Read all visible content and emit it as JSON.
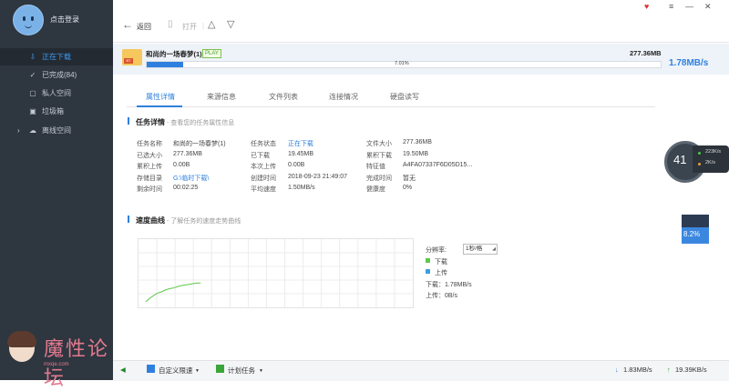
{
  "sidebar": {
    "login": "点击登录",
    "items": [
      {
        "icon": "download-icon",
        "glyph": "⇩",
        "label": "正在下载"
      },
      {
        "icon": "check-circle-icon",
        "glyph": "✓",
        "label": "已完成(84)"
      },
      {
        "icon": "lock-icon",
        "glyph": "▢",
        "label": "私人空间"
      },
      {
        "icon": "trash-icon",
        "glyph": "▣",
        "label": "垃圾箱"
      },
      {
        "icon": "cloud-icon",
        "glyph": "☁",
        "label": "离线空间"
      }
    ],
    "watermark": {
      "text": "魔性论坛",
      "sub": "mxqe.com"
    }
  },
  "toolbar": {
    "back": "返回",
    "open": "打开"
  },
  "task": {
    "name": "和尚的一场春梦(1)",
    "play": "PLAY",
    "size": "277.36MB",
    "progress_pct": 7.01,
    "progress_label": "7.01%",
    "speed": "1.78MB/s"
  },
  "tabs": [
    "属性详情",
    "来源信息",
    "文件列表",
    "连接情况",
    "硬盘读写"
  ],
  "details": {
    "title": "任务详情",
    "subtitle": " - 查看您的任务属性信息",
    "col1": [
      [
        "任务名称",
        "和尚的一场春梦(1)"
      ],
      [
        "已选大小",
        "277.36MB"
      ],
      [
        "累积上传",
        "0.00B"
      ],
      [
        "存储目录",
        "G:\\临时下载\\"
      ],
      [
        "剩余时间",
        "00:02:25"
      ]
    ],
    "col2": [
      [
        "任务状态",
        "正在下载"
      ],
      [
        "已下载",
        "19.45MB"
      ],
      [
        "本次上传",
        "0.00B"
      ],
      [
        "创建时间",
        "2018-09-23 21:49:07"
      ],
      [
        "平均速度",
        "1.50MB/s"
      ]
    ],
    "col3": [
      [
        "文件大小",
        "277.36MB"
      ],
      [
        "累积下载",
        "19.50MB"
      ],
      [
        "特征值",
        "A4FA07337F6D05D15..."
      ],
      [
        "完成时间",
        "暂无"
      ],
      [
        "健康度",
        "0%"
      ]
    ]
  },
  "speed_curve": {
    "title": "速度曲线",
    "subtitle": " - 了解任务的速度走势曲线",
    "resolution_label": "分辨率:",
    "resolution_value": "1秒/格",
    "legend_download": "下载",
    "legend_upload": "上传",
    "download_readout": "下载：1.78MB/s",
    "upload_readout": "上传：0B/s",
    "colors": {
      "download": "#5ec84a",
      "upload": "#3a9ee0"
    }
  },
  "chart_data": {
    "type": "line",
    "series": [
      {
        "name": "下载",
        "x": [
          0,
          1,
          2,
          3,
          4,
          5,
          6,
          7,
          8,
          9,
          10,
          11,
          12,
          13,
          14
        ],
        "values": [
          0.0,
          0.3,
          0.5,
          0.7,
          0.8,
          0.95,
          1.05,
          1.1,
          1.2,
          1.3,
          1.35,
          1.4,
          1.45,
          1.5,
          1.5
        ]
      }
    ],
    "grid": true,
    "ylim": [
      0,
      5
    ]
  },
  "widgets": {
    "gauge_value": "41",
    "gauge_unit": "%",
    "net_up": "223K/s",
    "net_down": "2K/s",
    "mini_value": "8.2%"
  },
  "bottom": {
    "custom_limit": "自定义限速",
    "scheduled": "计划任务",
    "down_speed": "1.83MB/s",
    "up_speed": "19.39KB/s"
  }
}
